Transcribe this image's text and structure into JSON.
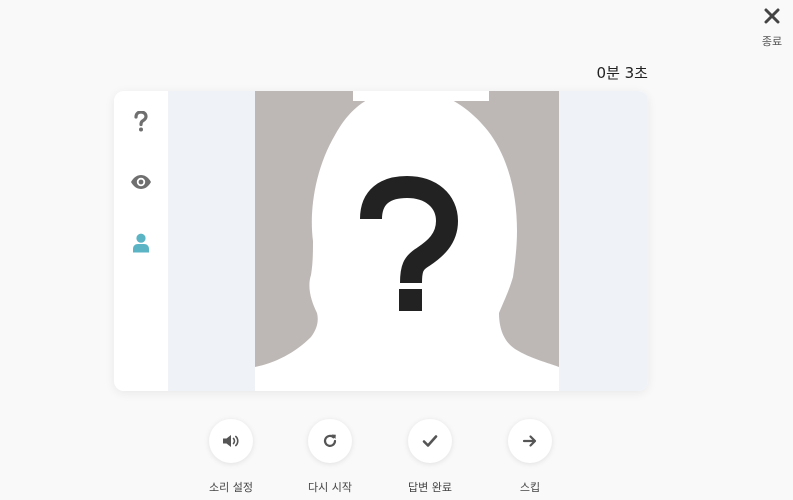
{
  "header": {
    "close_label": "종료",
    "close_icon": "close-icon",
    "timer": "0분 3초"
  },
  "sidebar": {
    "items": [
      {
        "name": "help",
        "icon": "question-icon"
      },
      {
        "name": "view",
        "icon": "eye-icon"
      },
      {
        "name": "profile",
        "icon": "user-icon",
        "active": true
      }
    ],
    "active_color": "#5bb4c4",
    "icon_color": "#7a7a7a"
  },
  "stage": {
    "image": "silhouette-with-question-mark",
    "background": "#bdb8b5"
  },
  "controls": [
    {
      "name": "sound-settings",
      "label": "소리 설정",
      "icon": "speaker-icon"
    },
    {
      "name": "restart",
      "label": "다시 시작",
      "icon": "refresh-icon"
    },
    {
      "name": "submit-answer",
      "label": "답변 완료",
      "icon": "check-icon"
    },
    {
      "name": "skip",
      "label": "스킵",
      "icon": "arrow-right-icon"
    }
  ]
}
